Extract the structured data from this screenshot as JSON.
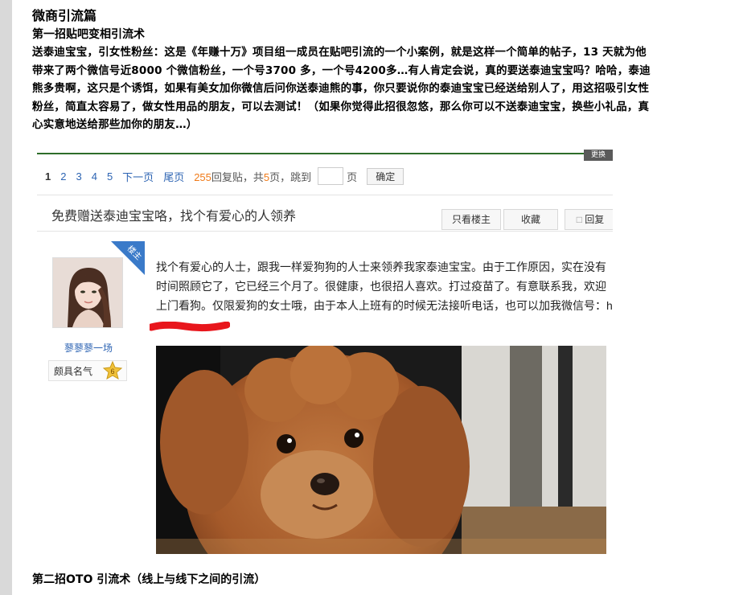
{
  "article": {
    "heading": "微商引流篇",
    "section1_title": "第一招贴吧变相引流术",
    "para_lines": [
      "送泰迪宝宝，引女性粉丝：这是《年赚十万》项目组一成员在贴吧引流的一个小案例，就是这样一个简单的帖子，13 天就为他",
      "带来了两个微信号近8000 个微信粉丝，一个号3700 多，一个号4200多…有人肯定会说，真的要送泰迪宝宝吗？哈哈，泰迪",
      "熊多贵啊，这只是个诱饵，如果有美女加你微信后问你送泰迪熊的事，你只要说你的泰迪宝宝已经送给别人了，用这招吸引女性",
      "粉丝，简直太容易了，做女性用品的朋友，可以去测试！（如果你觉得此招很忽悠，那么你可以不送泰迪宝宝，换些小礼品，真",
      "心实意地送给那些加你的朋友…）"
    ],
    "section2_title": "第二招OTO 引流术（线上与线下之间的引流）"
  },
  "forum": {
    "corner_label": "更换",
    "pager": {
      "pages": [
        "1",
        "2",
        "3",
        "4",
        "5"
      ],
      "next": "下一页",
      "last": "尾页",
      "reply_num": "255",
      "reply_text": "回复贴，共",
      "total_pages": "5",
      "total_suffix": "页，跳到",
      "page_unit": "页",
      "confirm": "确定"
    },
    "thread_title": "免费赠送泰迪宝宝咯，找个有爱心的人领养",
    "buttons": {
      "only_op": "只看楼主",
      "favorite": "收藏",
      "reply": "回复"
    },
    "author": {
      "badge": "楼主",
      "username": "蓼蓼蓼一场",
      "level_label": "颇具名气",
      "level": "6"
    },
    "post_lines": [
      "找个有爱心的人士，跟我一样爱狗狗的人士来领养我家泰迪宝宝。由于工作原因，实在没有",
      "时间照顾它了，它已经三个月了。很健康，也很招人喜欢。打过疫苗了。有意联系我，欢迎",
      "上门看狗。仅限爱狗的女士哦，由于本人上班有的时候无法接听电话，也可以加我微信号：h"
    ]
  },
  "colors": {
    "link": "#2d64b3",
    "highlight": "#f07a18",
    "badge": "#3a7ac9",
    "redact": "#e8161c"
  }
}
